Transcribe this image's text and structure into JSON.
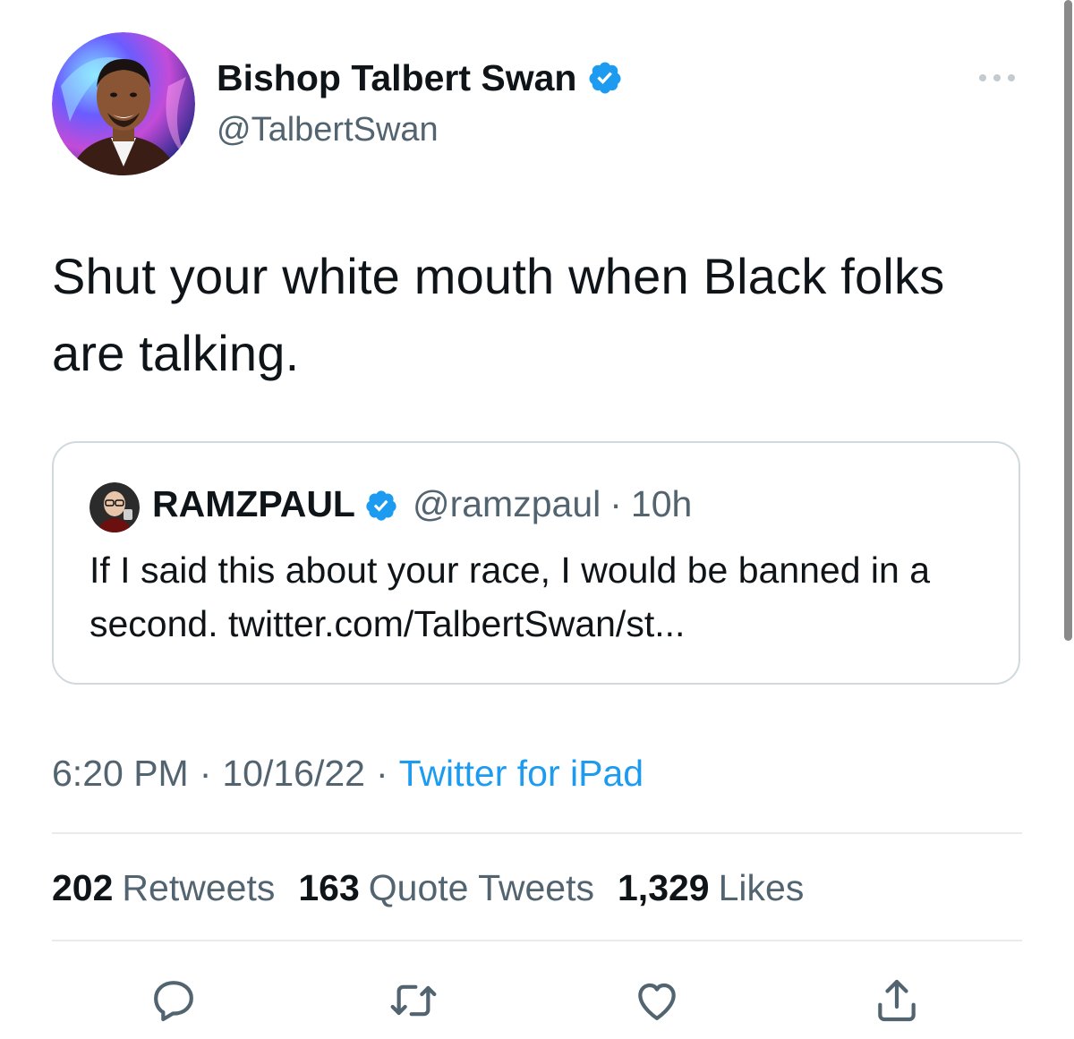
{
  "author": {
    "display_name": "Bishop Talbert Swan",
    "handle": "@TalbertSwan",
    "verified": true
  },
  "tweet": {
    "text": "Shut your white mouth when Black folks are talking."
  },
  "quoted_tweet": {
    "display_name": "RAMZPAUL",
    "handle": "@ramzpaul",
    "separator": "·",
    "time_ago": "10h",
    "text": "If I said this about your race, I would be banned in a second. twitter.com/TalbertSwan/st..."
  },
  "meta": {
    "time": "6:20 PM",
    "separator": "·",
    "date": "10/16/22",
    "source": "Twitter for iPad"
  },
  "stats": {
    "retweets_count": "202",
    "retweets_label": "Retweets",
    "quotes_count": "163",
    "quotes_label": "Quote Tweets",
    "likes_count": "1,329",
    "likes_label": "Likes"
  },
  "actions": {
    "reply_icon": "reply-icon",
    "retweet_icon": "retweet-icon",
    "like_icon": "heart-icon",
    "share_icon": "share-icon"
  },
  "colors": {
    "link_blue": "#1d9bf0",
    "secondary_text": "#536471",
    "primary_text": "#0f1419",
    "border": "#cfd9de"
  }
}
